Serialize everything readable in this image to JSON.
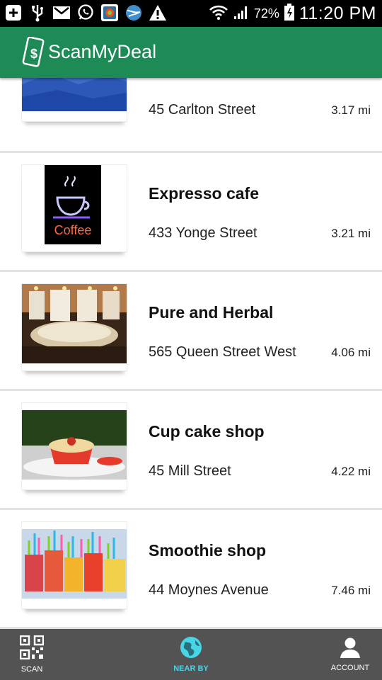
{
  "status_bar": {
    "battery_percent": "72%",
    "time": "11:20 PM",
    "left_icons": [
      "add-icon",
      "usb-icon",
      "gmail-icon",
      "whatsapp-icon",
      "app-icon",
      "browser-icon",
      "warning-icon"
    ],
    "right_icons": [
      "wifi-icon",
      "signal-icon",
      "battery-icon"
    ]
  },
  "app_bar": {
    "title": "ScanMyDeal",
    "color": "#1e8b57"
  },
  "places": [
    {
      "name": "",
      "address": "45 Carlton Street",
      "distance": "3.17 mi",
      "image": "mountain-photo"
    },
    {
      "name": "Expresso cafe",
      "address": "433 Yonge Street",
      "distance": "3.21 mi",
      "image": "coffee-neon-sign"
    },
    {
      "name": "Pure and Herbal",
      "address": "565 Queen Street West",
      "distance": "4.06 mi",
      "image": "spa-pool-photo"
    },
    {
      "name": "Cup cake shop",
      "address": "45 Mill Street",
      "distance": "4.22 mi",
      "image": "cupcake-photo"
    },
    {
      "name": "Smoothie shop",
      "address": "44 Moynes Avenue",
      "distance": "7.46 mi",
      "image": "smoothie-photo"
    }
  ],
  "coffee_sign_text": "Coffee",
  "bottom_nav": {
    "items": [
      {
        "label": "SCAN",
        "icon": "qr-code-icon",
        "active": false
      },
      {
        "label": "NEAR BY",
        "icon": "globe-icon",
        "active": true
      },
      {
        "label": "ACCOUNT",
        "icon": "person-icon",
        "active": false
      }
    ],
    "active_color": "#47d5e8"
  }
}
